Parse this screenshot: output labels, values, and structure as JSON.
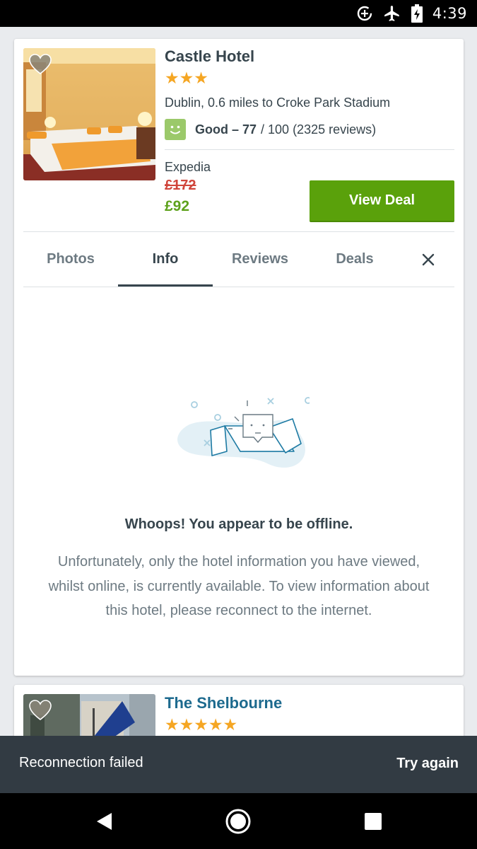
{
  "status_bar": {
    "time": "4:39",
    "icons": [
      "data-saver-icon",
      "airplane-mode-icon",
      "battery-charging-icon"
    ]
  },
  "hotels": [
    {
      "name": "Castle Hotel",
      "stars": "★★★",
      "star_count": 3,
      "location": "Dublin, 0.6 miles to Croke Park Stadium",
      "rating_label": "Good – 77",
      "rating_rest": "/ 100 (2325 reviews)",
      "provider": "Expedia",
      "old_price": "£172",
      "new_price": "£92",
      "cta": "View Deal"
    },
    {
      "name": "The Shelbourne",
      "stars": "★★★★★",
      "star_count": 5
    }
  ],
  "tabs": [
    {
      "label": "Photos",
      "active": false
    },
    {
      "label": "Info",
      "active": true
    },
    {
      "label": "Reviews",
      "active": false
    },
    {
      "label": "Deals",
      "active": false
    }
  ],
  "offline": {
    "title": "Whoops! You appear to be offline.",
    "body": "Unfortunately, only the hotel information you have viewed, whilst online, is currently available. To view information about this hotel, please reconnect to the internet."
  },
  "snackbar": {
    "message": "Reconnection failed",
    "action": "Try again"
  },
  "colors": {
    "cta_green": "#5aa10b",
    "new_price_green": "#5ea21c",
    "old_price_red": "#d0453b",
    "star_orange": "#f5a623",
    "rating_green": "#9bc96a",
    "link_blue": "#1d6a8e",
    "snackbar_bg": "#323b43"
  }
}
